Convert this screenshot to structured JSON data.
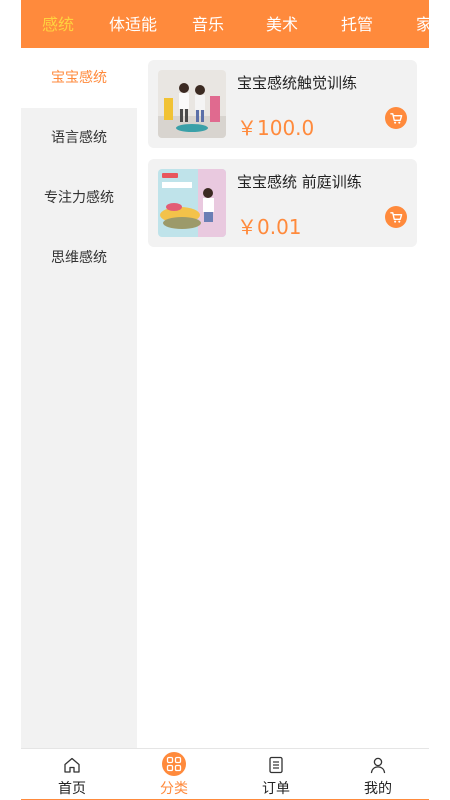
{
  "top_tabs": [
    {
      "label": "感统",
      "active": true
    },
    {
      "label": "体适能",
      "active": false
    },
    {
      "label": "音乐",
      "active": false
    },
    {
      "label": "美术",
      "active": false
    },
    {
      "label": "托管",
      "active": false
    },
    {
      "label": "家",
      "active": false
    }
  ],
  "sidebar": {
    "items": [
      {
        "label": "宝宝感统",
        "active": true
      },
      {
        "label": "语言感统",
        "active": false
      },
      {
        "label": "专注力感统",
        "active": false
      },
      {
        "label": "思维感统",
        "active": false
      }
    ]
  },
  "products": [
    {
      "name": "宝宝感统触觉训练",
      "price": "￥100.0",
      "thumb_icon": "children-balance-photo"
    },
    {
      "name": "宝宝感统 前庭训练",
      "price": "￥0.01",
      "thumb_icon": "children-toy-photo"
    }
  ],
  "bottom_nav": [
    {
      "label": "首页",
      "icon": "home-icon",
      "active": false
    },
    {
      "label": "分类",
      "icon": "grid-icon",
      "active": true
    },
    {
      "label": "订单",
      "icon": "order-list-icon",
      "active": false
    },
    {
      "label": "我的",
      "icon": "user-icon",
      "active": false
    }
  ],
  "colors": {
    "accent": "#ff8a3c",
    "active_tab": "#ffd23f",
    "panel": "#f2f2f2"
  }
}
